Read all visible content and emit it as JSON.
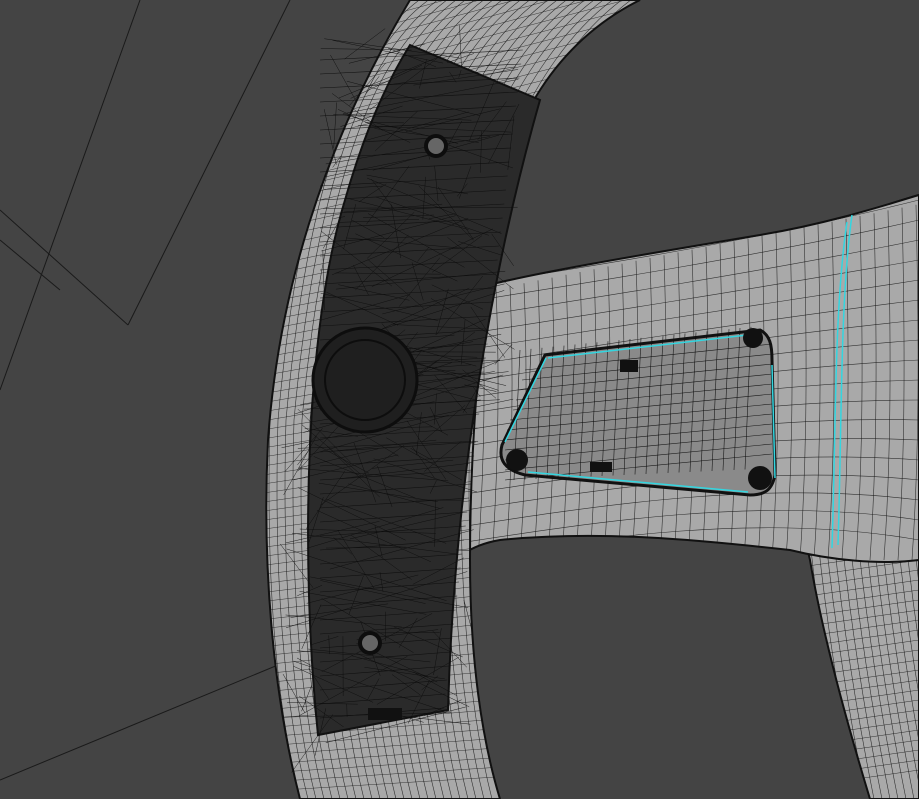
{
  "viewport": {
    "background_color": "#444444",
    "mesh_fill_color": "#a9a9a9",
    "mesh_shadow_color": "#7f7f7f",
    "wire_color": "#111111",
    "selection_color": "#33d6e0"
  }
}
